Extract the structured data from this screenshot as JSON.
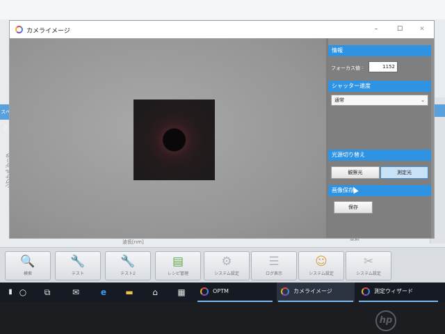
{
  "camera_window": {
    "title": "カメライメージ",
    "controls": {
      "minimize": "–",
      "maximize": "☐",
      "close": "✕"
    }
  },
  "side_panel": {
    "info": {
      "header": "情報",
      "focus_label": "フォーカス値",
      "focus_colon": ":",
      "focus_value": "1152"
    },
    "shutter": {
      "header": "シャッター速度",
      "selected": "通常",
      "chevron": "⌄"
    },
    "light_source": {
      "header": "光源切り替え",
      "observe_label": "観察光",
      "measure_label": "測定光",
      "active": "測定光"
    },
    "image_save": {
      "header": "画像保存",
      "save_label": "保存"
    }
  },
  "background_app": {
    "side_tab": "スペク",
    "vertical_label": "シグナル データ",
    "x_axis_label": "波長[nm]",
    "right_label": "波数",
    "toolbar": [
      {
        "label": "検索",
        "icon": "search-icon"
      },
      {
        "label": "テスト",
        "icon": "test-icon"
      },
      {
        "label": "テスト2",
        "icon": "test-icon"
      },
      {
        "label": "レシピ管理",
        "icon": "books-icon"
      },
      {
        "label": "システム設定",
        "icon": "gear-icon"
      },
      {
        "label": "ログ表示",
        "icon": "log-icon"
      },
      {
        "label": "システム設定",
        "icon": "user-icon"
      },
      {
        "label": "システム設定",
        "icon": "tools-icon"
      }
    ]
  },
  "taskbar": {
    "apps": [
      {
        "label": "OPTM",
        "icon": "optm-ring-icon"
      },
      {
        "label": "カメライメージ",
        "icon": "optm-ring-icon"
      },
      {
        "label": "測定ウィザード",
        "icon": "optm-ring-icon"
      }
    ]
  },
  "brand": "hp",
  "colors": {
    "accent_blue": "#2f93e3",
    "panel_gray": "#7f7f7f",
    "taskbar": "#151a23"
  }
}
